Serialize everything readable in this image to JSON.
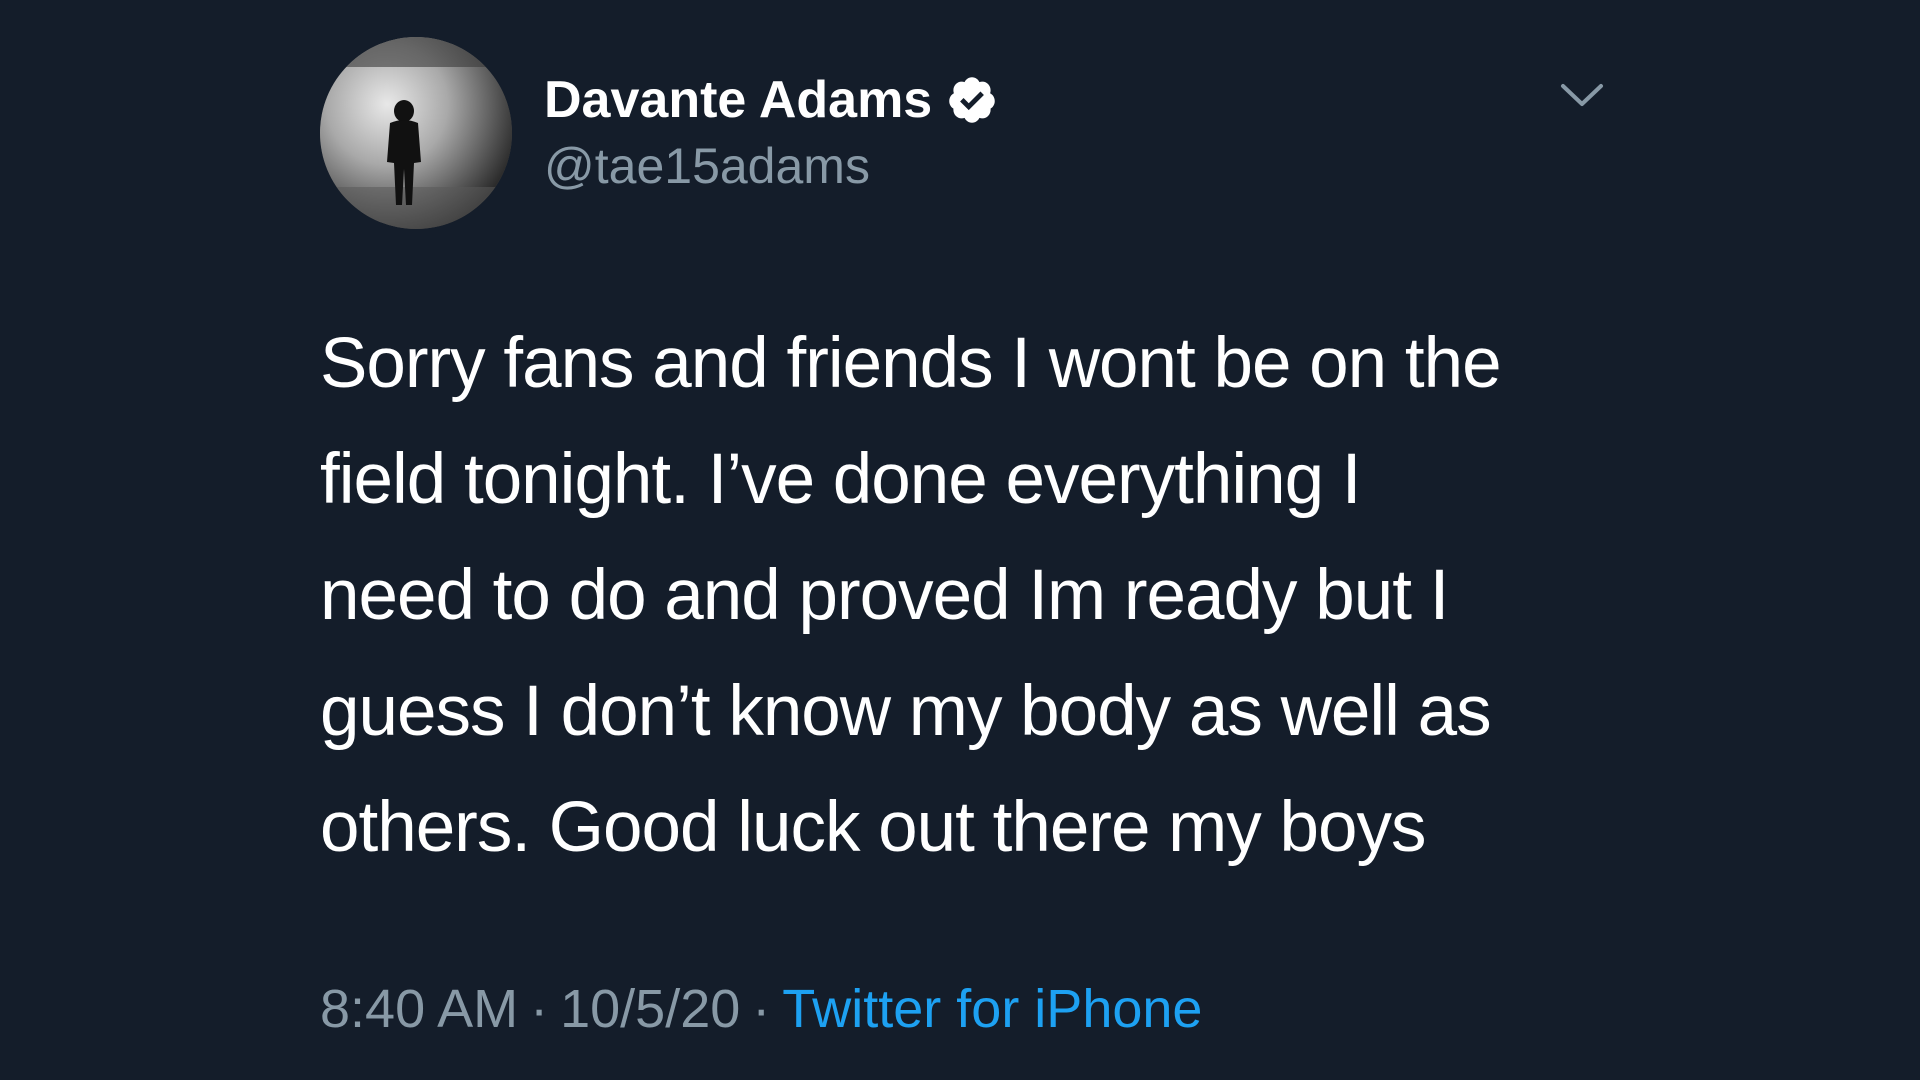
{
  "tweet": {
    "author": {
      "display_name": "Davante Adams",
      "handle": "@tae15adams",
      "verified": true
    },
    "body_lines": [
      "Sorry fans and friends I wont be on the",
      "field tonight. I’ve done everything I",
      "need to do and proved Im ready but I",
      "guess I don’t know my body as well as",
      "others. Good luck out there my boys"
    ],
    "time": "8:40 AM",
    "date": "10/5/20",
    "separator": "·",
    "source": "Twitter for iPhone"
  },
  "icons": {
    "verified": "verified-badge-icon",
    "menu": "chevron-down-icon"
  },
  "colors": {
    "background": "#141d2a",
    "text": "#ffffff",
    "secondary_text": "#8899a6",
    "link": "#1da1f2"
  }
}
